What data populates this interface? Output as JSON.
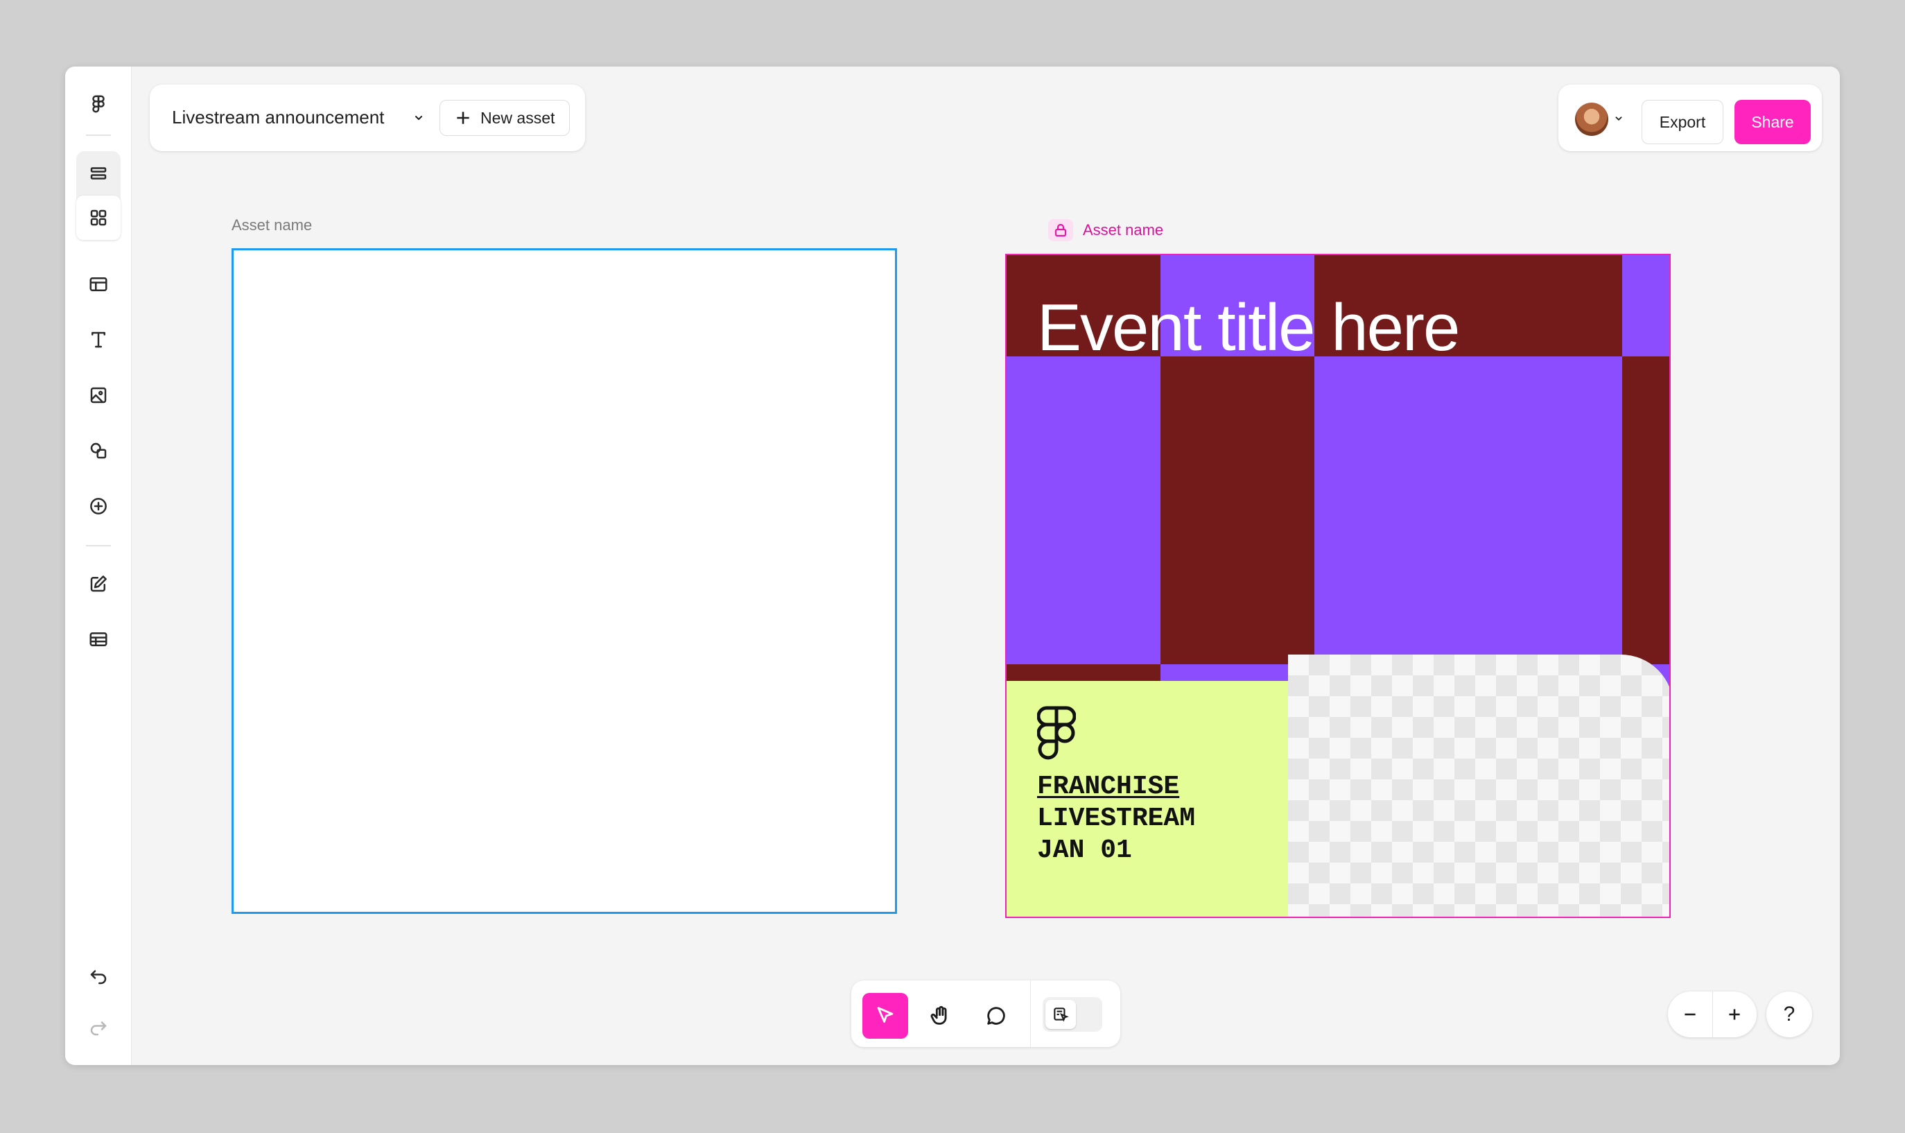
{
  "header": {
    "doc_title": "Livestream announcement",
    "new_asset_label": "New asset",
    "export_label": "Export",
    "share_label": "Share"
  },
  "canvas": {
    "asset_1": {
      "name": "Asset name"
    },
    "asset_2": {
      "name": "Asset name",
      "locked": true,
      "event_title": "Event title here",
      "brand_lines": [
        "FRANCHISE",
        "LIVESTREAM",
        "JAN 01"
      ]
    }
  },
  "sidebar": {
    "icons": [
      "figma-logo-icon",
      "layers-icon",
      "grid-icon",
      "layout-icon",
      "text-icon",
      "image-icon",
      "shapes-icon",
      "plus-circle-icon",
      "edit-icon",
      "table-icon",
      "undo-icon",
      "redo-icon"
    ]
  },
  "toolbar": {
    "tools": [
      "pointer-icon",
      "hand-icon",
      "comment-icon",
      "mode-toggle-icon"
    ]
  },
  "zoom": {
    "help_label": "?"
  },
  "colors": {
    "accent": "#ff24bd",
    "selection_blue": "#1d9bf0",
    "purple": "#8b4dff",
    "maroon": "#731b1b",
    "lime": "#e4fd97"
  }
}
